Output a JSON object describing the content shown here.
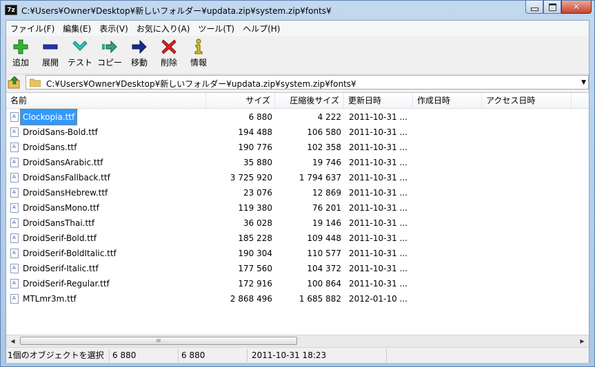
{
  "window": {
    "app_icon_text": "7z",
    "title": "C:¥Users¥Owner¥Desktop¥新しいフォルダー¥updata.zip¥system.zip¥fonts¥"
  },
  "menu": [
    "ファイル(F)",
    "編集(E)",
    "表示(V)",
    "お気に入り(A)",
    "ツール(T)",
    "ヘルプ(H)"
  ],
  "toolbar": {
    "add": "追加",
    "extract": "展開",
    "test": "テスト",
    "copy": "コピー",
    "move": "移動",
    "delete": "削除",
    "info": "情報"
  },
  "address": {
    "path": "C:¥Users¥Owner¥Desktop¥新しいフォルダー¥updata.zip¥system.zip¥fonts¥"
  },
  "columns": {
    "name": "名前",
    "size": "サイズ",
    "packed": "圧縮後サイズ",
    "modified": "更新日時",
    "created": "作成日時",
    "accessed": "アクセス日時"
  },
  "files": [
    {
      "name": "Clockopia.ttf",
      "size": "6 880",
      "packed": "4 222",
      "modified": "2011-10-31 ..."
    },
    {
      "name": "DroidSans-Bold.ttf",
      "size": "194 488",
      "packed": "106 580",
      "modified": "2011-10-31 ..."
    },
    {
      "name": "DroidSans.ttf",
      "size": "190 776",
      "packed": "102 358",
      "modified": "2011-10-31 ..."
    },
    {
      "name": "DroidSansArabic.ttf",
      "size": "35 880",
      "packed": "19 746",
      "modified": "2011-10-31 ..."
    },
    {
      "name": "DroidSansFallback.ttf",
      "size": "3 725 920",
      "packed": "1 794 637",
      "modified": "2011-10-31 ..."
    },
    {
      "name": "DroidSansHebrew.ttf",
      "size": "23 076",
      "packed": "12 869",
      "modified": "2011-10-31 ..."
    },
    {
      "name": "DroidSansMono.ttf",
      "size": "119 380",
      "packed": "76 201",
      "modified": "2011-10-31 ..."
    },
    {
      "name": "DroidSansThai.ttf",
      "size": "36 028",
      "packed": "19 146",
      "modified": "2011-10-31 ..."
    },
    {
      "name": "DroidSerif-Bold.ttf",
      "size": "185 228",
      "packed": "109 448",
      "modified": "2011-10-31 ..."
    },
    {
      "name": "DroidSerif-BoldItalic.ttf",
      "size": "190 304",
      "packed": "110 577",
      "modified": "2011-10-31 ..."
    },
    {
      "name": "DroidSerif-Italic.ttf",
      "size": "177 560",
      "packed": "104 372",
      "modified": "2011-10-31 ..."
    },
    {
      "name": "DroidSerif-Regular.ttf",
      "size": "172 916",
      "packed": "100 864",
      "modified": "2011-10-31 ..."
    },
    {
      "name": "MTLmr3m.ttf",
      "size": "2 868 496",
      "packed": "1 685 882",
      "modified": "2012-01-10 ..."
    }
  ],
  "selected_index": 0,
  "scrollbar": {
    "thumb_grip": "III"
  },
  "status": {
    "selection": "1個のオブジェクトを選択",
    "size": "6 880",
    "packed": "6 880",
    "modified": "2011-10-31 18:23"
  },
  "colors": {
    "selection": "#3399ff",
    "title_bg": "#b9d1ea",
    "close_button": "#c7432b"
  }
}
